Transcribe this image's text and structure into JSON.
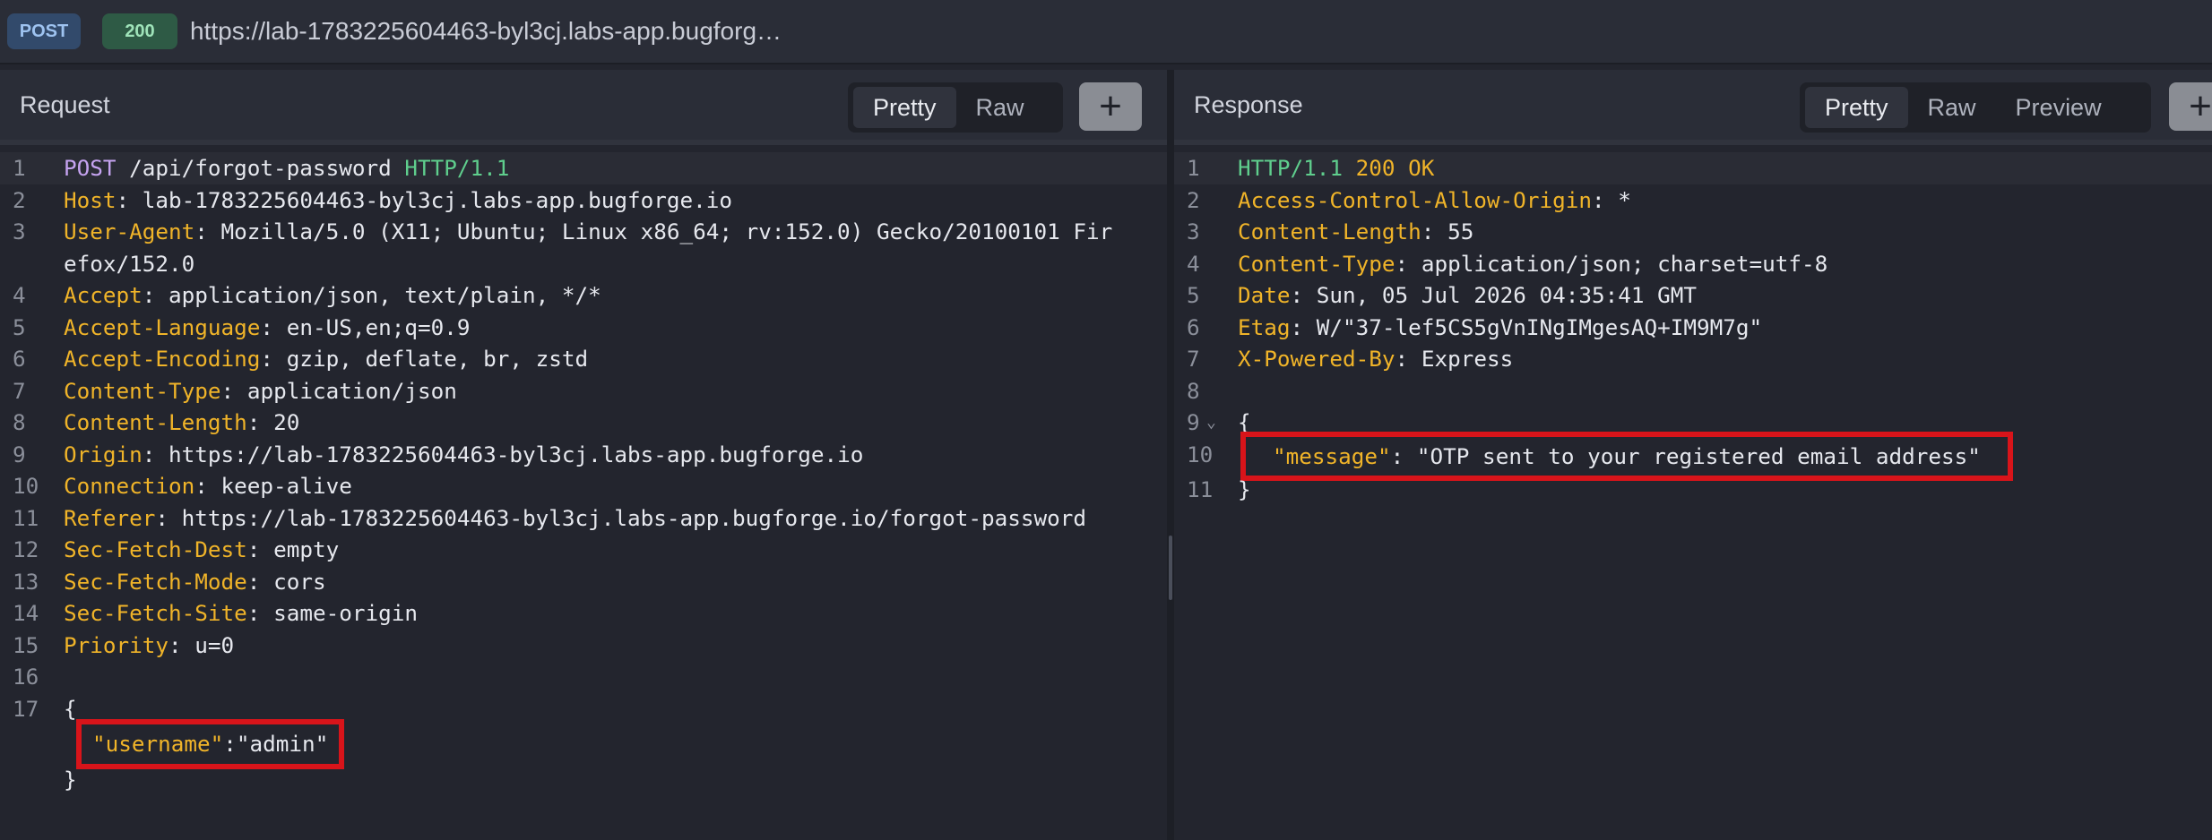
{
  "topbar": {
    "method": "POST",
    "status": "200",
    "url": "https://lab-1783225604463-byl3cj.labs-app.bugforg…"
  },
  "request": {
    "title": "Request",
    "tabs": [
      "Pretty",
      "Raw"
    ],
    "active_tab": "Pretty",
    "plus_label": "+",
    "line_numbers": [
      "1",
      "2",
      "3",
      "",
      "4",
      "5",
      "6",
      "7",
      "8",
      "9",
      "10",
      "11",
      "12",
      "13",
      "14",
      "15",
      "16",
      "17",
      "",
      ""
    ],
    "request_line": {
      "method": "POST",
      "path": " /api/forgot-password ",
      "version": "HTTP/1.1"
    },
    "headers": [
      {
        "name": "Host",
        "value": "lab-1783225604463-byl3cj.labs-app.bugforge.io"
      },
      {
        "name": "User-Agent",
        "value": "Mozilla/5.0 (X11; Ubuntu; Linux x86_64; rv:152.0) Gecko/20100101 Fir"
      },
      {
        "name": "",
        "value": "efox/152.0"
      },
      {
        "name": "Accept",
        "value": "application/json, text/plain, */*"
      },
      {
        "name": "Accept-Language",
        "value": "en-US,en;q=0.9"
      },
      {
        "name": "Accept-Encoding",
        "value": "gzip, deflate, br, zstd"
      },
      {
        "name": "Content-Type",
        "value": "application/json"
      },
      {
        "name": "Content-Length",
        "value": "20"
      },
      {
        "name": "Origin",
        "value": "https://lab-1783225604463-byl3cj.labs-app.bugforge.io"
      },
      {
        "name": "Connection",
        "value": "keep-alive"
      },
      {
        "name": "Referer",
        "value": "https://lab-1783225604463-byl3cj.labs-app.bugforge.io/forgot-password"
      },
      {
        "name": "Sec-Fetch-Dest",
        "value": "empty"
      },
      {
        "name": "Sec-Fetch-Mode",
        "value": "cors"
      },
      {
        "name": "Sec-Fetch-Site",
        "value": "same-origin"
      },
      {
        "name": "Priority",
        "value": "u=0"
      }
    ],
    "body_open": "{",
    "body_key": "\"username\"",
    "body_sep": ":",
    "body_value": "\"admin\"",
    "body_close": "}"
  },
  "response": {
    "title": "Response",
    "tabs": [
      "Pretty",
      "Raw",
      "Preview"
    ],
    "active_tab": "Pretty",
    "plus_label": "+",
    "line_numbers": [
      "1",
      "2",
      "3",
      "4",
      "5",
      "6",
      "7",
      "8",
      "9",
      "10",
      "11"
    ],
    "status_line": {
      "version": "HTTP/1.1",
      "code": " 200",
      "text": " OK"
    },
    "headers": [
      {
        "name": "Access-Control-Allow-Origin",
        "value": "*"
      },
      {
        "name": "Content-Length",
        "value": "55"
      },
      {
        "name": "Content-Type",
        "value": "application/json; charset=utf-8"
      },
      {
        "name": "Date",
        "value": "Sun, 05 Jul 2026 04:35:41 GMT"
      },
      {
        "name": "Etag",
        "value": "W/\"37-lef5CS5gVnINgIMgesAQ+IM9M7g\""
      },
      {
        "name": "X-Powered-By",
        "value": "Express"
      }
    ],
    "fold_icon": "⌄",
    "body_open": "{",
    "body_key": "\"message\"",
    "body_sep": ": ",
    "body_value": "\"OTP sent to your registered email address\"",
    "body_close": "}"
  },
  "colors": {
    "header_key": "#f0b429",
    "keyword": "#c5a3f0",
    "http_version": "#5fce8d",
    "highlight_box": "#d8141a"
  }
}
